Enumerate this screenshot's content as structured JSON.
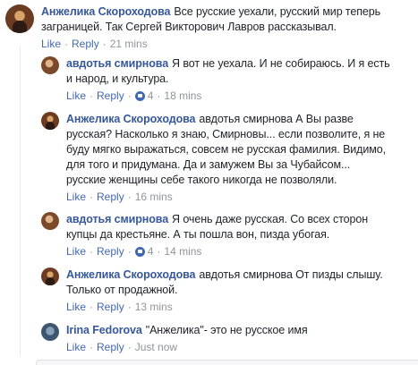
{
  "comments": [
    {
      "author": "Анжелика Скороходова",
      "line1": "Все русские уехали, русский мир теперь",
      "line2": "заграницей. Так Сергей Викторович Лавров рассказывал.",
      "like": "Like",
      "reply": "Reply",
      "time": "21 mins"
    },
    {
      "author": "авдотья смирнова",
      "line1": "Я вот не уехала. И не собираюсь. И я есть",
      "line2": "и народ, и культура.",
      "like": "Like",
      "reply": "Reply",
      "likes": "4",
      "time": "18 mins"
    },
    {
      "author": "Анжелика Скороходова",
      "line1": "авдотья смирнова А Вы разве",
      "line2": "русская? Насколько я знаю, Смирновы... если позволите, я не",
      "line3": "буду мягко выражаться, совсем не русская фамилия. Видимо,",
      "line4": "для того и придумана. Да и замужем Вы за Чубайсом...",
      "line5": "русские женщины себе такого никогда не позволяли.",
      "like": "Like",
      "reply": "Reply",
      "time": "16 mins"
    },
    {
      "author": "авдотья смирнова",
      "line1": "Я очень даже русская. Со всех сторон",
      "line2": "купцы да крестьяне. А ты пошла вон, пизда убогая.",
      "like": "Like",
      "reply": "Reply",
      "likes": "4",
      "time": "14 mins"
    },
    {
      "author": "Анжелика Скороходова",
      "line1": "авдотья смирнова От пизды слышу.",
      "line2": "Только от продажной.",
      "like": "Like",
      "reply": "Reply",
      "time": "13 mins"
    },
    {
      "author": "Irina Fedorova",
      "line1": "\"Анжелика\"- это не русское имя",
      "like": "Like",
      "reply": "Reply",
      "time": "Just now"
    }
  ],
  "separator": "·",
  "colors": {
    "author": "#365899",
    "action_link": "#4267b2",
    "meta": "#90949c",
    "text": "#1d2129",
    "like_badge": "#4267b2"
  }
}
